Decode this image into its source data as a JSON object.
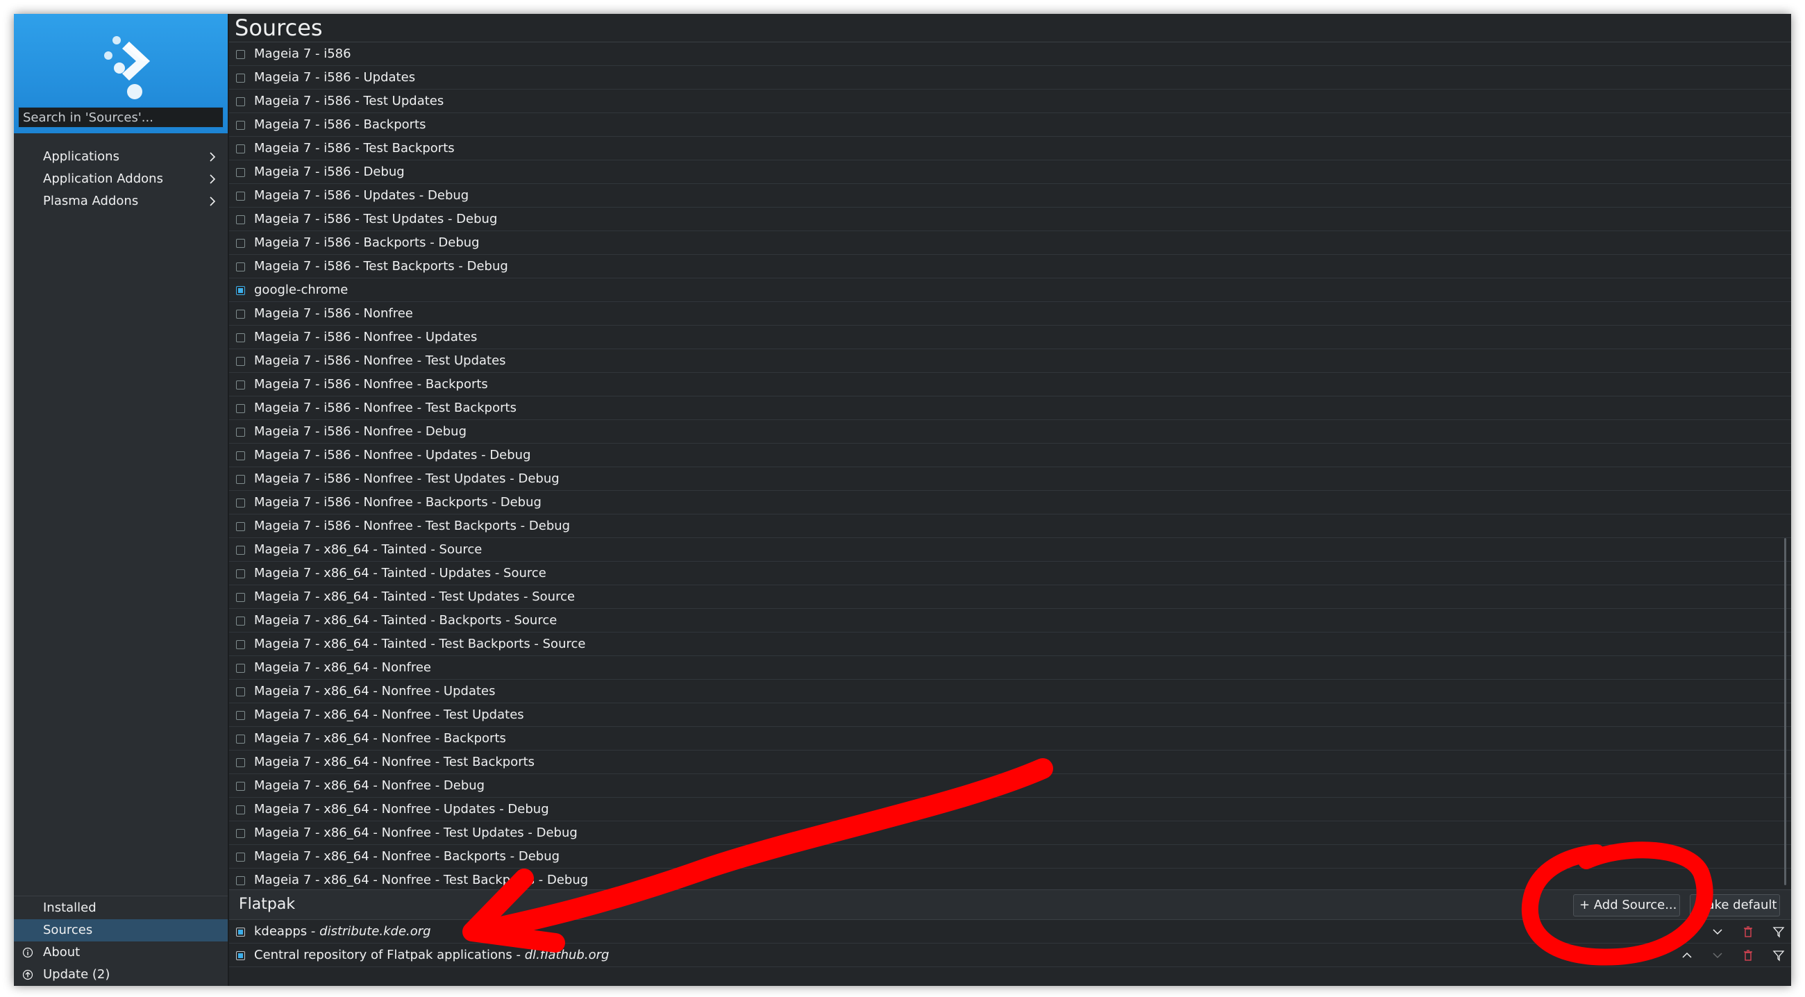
{
  "window": {
    "title": "Sources"
  },
  "sidebar": {
    "search_placeholder": "Search in 'Sources'...",
    "categories": [
      {
        "label": "Applications"
      },
      {
        "label": "Application Addons"
      },
      {
        "label": "Plasma Addons"
      }
    ],
    "bottom": [
      {
        "label": "Installed"
      },
      {
        "label": "Sources"
      },
      {
        "label": "About"
      },
      {
        "label": "Update (2)"
      }
    ]
  },
  "sources": [
    {
      "label": "Mageia 7 - i586",
      "enabled": false
    },
    {
      "label": "Mageia 7 - i586 - Updates",
      "enabled": false
    },
    {
      "label": "Mageia 7 - i586 - Test Updates",
      "enabled": false
    },
    {
      "label": "Mageia 7 - i586 - Backports",
      "enabled": false
    },
    {
      "label": "Mageia 7 - i586 - Test Backports",
      "enabled": false
    },
    {
      "label": "Mageia 7 - i586 - Debug",
      "enabled": false
    },
    {
      "label": "Mageia 7 - i586 - Updates - Debug",
      "enabled": false
    },
    {
      "label": "Mageia 7 - i586 - Test Updates - Debug",
      "enabled": false
    },
    {
      "label": "Mageia 7 - i586 - Backports - Debug",
      "enabled": false
    },
    {
      "label": "Mageia 7 - i586 - Test Backports - Debug",
      "enabled": false
    },
    {
      "label": "google-chrome",
      "enabled": true
    },
    {
      "label": "Mageia 7 - i586 - Nonfree",
      "enabled": false
    },
    {
      "label": "Mageia 7 - i586 - Nonfree - Updates",
      "enabled": false
    },
    {
      "label": "Mageia 7 - i586 - Nonfree - Test Updates",
      "enabled": false
    },
    {
      "label": "Mageia 7 - i586 - Nonfree - Backports",
      "enabled": false
    },
    {
      "label": "Mageia 7 - i586 - Nonfree - Test Backports",
      "enabled": false
    },
    {
      "label": "Mageia 7 - i586 - Nonfree - Debug",
      "enabled": false
    },
    {
      "label": "Mageia 7 - i586 - Nonfree - Updates - Debug",
      "enabled": false
    },
    {
      "label": "Mageia 7 - i586 - Nonfree - Test Updates - Debug",
      "enabled": false
    },
    {
      "label": "Mageia 7 - i586 - Nonfree - Backports - Debug",
      "enabled": false
    },
    {
      "label": "Mageia 7 - i586 - Nonfree - Test Backports - Debug",
      "enabled": false
    },
    {
      "label": "Mageia 7 - x86_64 - Tainted - Source",
      "enabled": false
    },
    {
      "label": "Mageia 7 - x86_64 - Tainted - Updates - Source",
      "enabled": false
    },
    {
      "label": "Mageia 7 - x86_64 - Tainted - Test Updates - Source",
      "enabled": false
    },
    {
      "label": "Mageia 7 - x86_64 - Tainted - Backports - Source",
      "enabled": false
    },
    {
      "label": "Mageia 7 - x86_64 - Tainted - Test Backports - Source",
      "enabled": false
    },
    {
      "label": "Mageia 7 - x86_64 - Nonfree",
      "enabled": false
    },
    {
      "label": "Mageia 7 - x86_64 - Nonfree - Updates",
      "enabled": false
    },
    {
      "label": "Mageia 7 - x86_64 - Nonfree - Test Updates",
      "enabled": false
    },
    {
      "label": "Mageia 7 - x86_64 - Nonfree - Backports",
      "enabled": false
    },
    {
      "label": "Mageia 7 - x86_64 - Nonfree - Test Backports",
      "enabled": false
    },
    {
      "label": "Mageia 7 - x86_64 - Nonfree - Debug",
      "enabled": false
    },
    {
      "label": "Mageia 7 - x86_64 - Nonfree - Updates - Debug",
      "enabled": false
    },
    {
      "label": "Mageia 7 - x86_64 - Nonfree - Test Updates - Debug",
      "enabled": false
    },
    {
      "label": "Mageia 7 - x86_64 - Nonfree - Backports - Debug",
      "enabled": false
    },
    {
      "label": "Mageia 7 - x86_64 - Nonfree - Test Backports - Debug",
      "enabled": false
    }
  ],
  "flatpak": {
    "title": "Flatpak",
    "add_source_label": "+ Add Source...",
    "make_default_label": "Make default",
    "repos": [
      {
        "name": "kdeapps",
        "separator": " - ",
        "url": "distribute.kde.org",
        "can_move_up": false,
        "can_move_down": true
      },
      {
        "name": "Central repository of Flatpak applications",
        "separator": " - ",
        "url": "dl.flathub.org",
        "can_move_up": true,
        "can_move_down": false
      }
    ]
  },
  "icons": {
    "logo": "discover-logo-icon",
    "chevron": "chevron-right-icon",
    "about": "info-icon",
    "update": "update-icon",
    "delete": "trash-icon",
    "filter": "filter-icon"
  },
  "colors": {
    "accent": "#3daee9",
    "header": "#1d84d4",
    "background": "#232629",
    "delete": "#da4453",
    "annotation": "#ff0000"
  }
}
